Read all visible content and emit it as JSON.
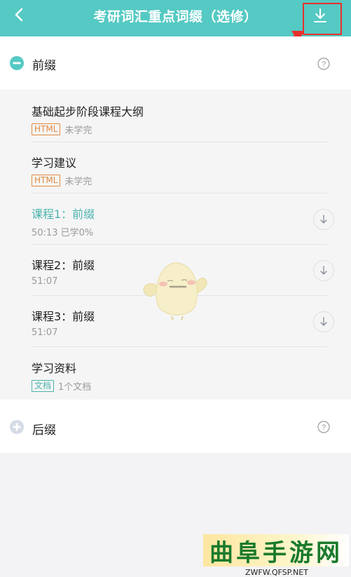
{
  "header": {
    "title": "考研词汇重点词缀（选修）",
    "back_icon": "chevron-left-icon",
    "download_icon": "download-icon"
  },
  "sections": [
    {
      "label": "前缀",
      "expanded": true,
      "icon": "minus-circle-icon"
    },
    {
      "label": "后缀",
      "expanded": false,
      "icon": "plus-circle-icon"
    }
  ],
  "lessons": [
    {
      "title": "基础起步阶段课程大纲",
      "tag": "HTML",
      "meta": "未学完"
    },
    {
      "title": "学习建议",
      "tag": "HTML",
      "meta": "未学完"
    },
    {
      "title": "课程1：前缀",
      "meta": "50:13  已学0%",
      "active": true,
      "downloadable": true
    },
    {
      "title": "课程2：前缀",
      "meta": "51:07",
      "downloadable": true
    },
    {
      "title": "课程3：前缀",
      "meta": "51:07",
      "downloadable": true
    },
    {
      "title": "学习资料",
      "tag": "文档",
      "meta": "1个文档"
    }
  ],
  "colors": {
    "accent": "#55c9c3",
    "active_text": "#4bb3ac",
    "html_tag": "#e28a3f",
    "annotation_red": "#e8302b"
  },
  "watermark": {
    "logo_text": "曲阜手游网",
    "url": "ZWFW.QFSP.NET"
  }
}
